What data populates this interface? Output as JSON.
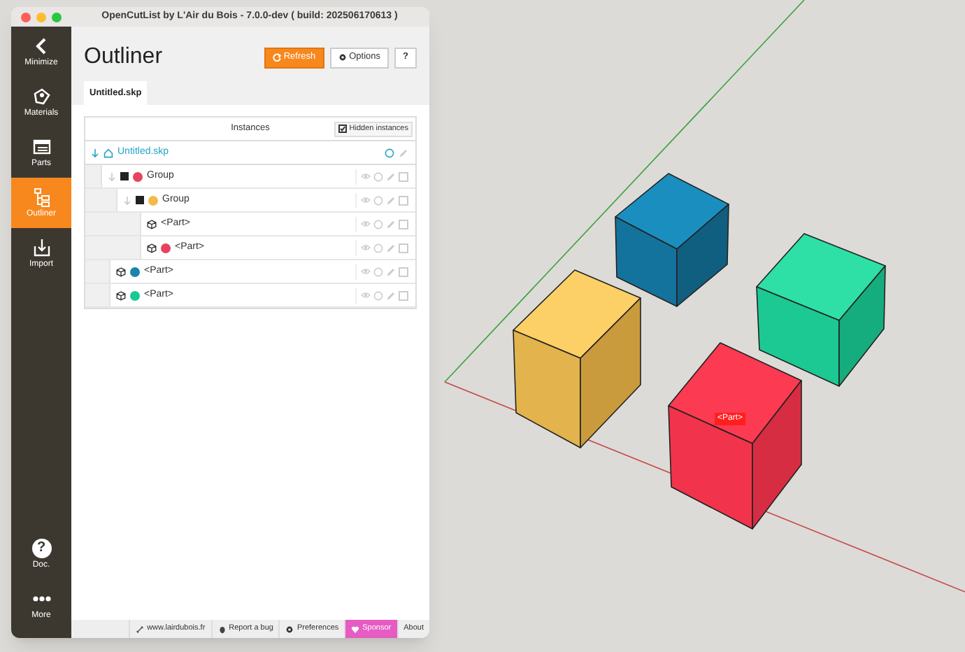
{
  "window": {
    "title": "OpenCutList by L'Air du Bois - 7.0.0-dev ( build: 202506170613 )"
  },
  "sidebar": {
    "items": [
      {
        "label": "Minimize",
        "kind": "chevron",
        "selected": false
      },
      {
        "label": "Materials",
        "kind": "materials",
        "selected": false
      },
      {
        "label": "Parts",
        "kind": "parts",
        "selected": false
      },
      {
        "label": "Outliner",
        "kind": "outliner",
        "selected": true
      },
      {
        "label": "Import",
        "kind": "import",
        "selected": false
      }
    ],
    "bottom_items": [
      {
        "label": "Doc.",
        "kind": "help",
        "symbol": "?"
      },
      {
        "label": "More",
        "kind": "dots"
      }
    ]
  },
  "header": {
    "title": "Outliner",
    "buttons": [
      {
        "label": "Refresh",
        "kind": "primary"
      },
      {
        "label": "Options",
        "kind": "options"
      },
      {
        "label": "?",
        "kind": "help"
      }
    ]
  },
  "tabs": [
    {
      "label": "Untitled.skp",
      "selected": true
    }
  ],
  "outliner": {
    "column": "Instances",
    "hidden_instances": {
      "label": "Hidden instances",
      "checked": true
    },
    "root": {
      "name": "Untitled.skp",
      "expanded": true,
      "children": [
        {
          "kind": "group",
          "name": "Group",
          "color": "#e8435e",
          "expanded": true,
          "checked": false,
          "children": [
            {
              "kind": "group",
              "name": "Group",
              "color": "#f2bb4b",
              "expanded": true,
              "checked": false,
              "children": [
                {
                  "kind": "part",
                  "name": "<Part>",
                  "checked": false
                },
                {
                  "kind": "part",
                  "name": "<Part>",
                  "color": "#e8435e",
                  "checked": false
                }
              ]
            }
          ]
        },
        {
          "kind": "part",
          "name": "<Part>",
          "color": "#1a84ad",
          "checked": false
        },
        {
          "kind": "part",
          "name": "<Part>",
          "color": "#18c993",
          "checked": false
        }
      ]
    }
  },
  "footer": [
    {
      "label": "www.lairdubois.fr",
      "kind": "link"
    },
    {
      "label": "Report a bug",
      "kind": "bug"
    },
    {
      "label": "Preferences",
      "kind": "gear"
    },
    {
      "label": "Sponsor",
      "kind": "sponsor"
    },
    {
      "label": "About",
      "kind": "plain"
    }
  ],
  "viewport": {
    "tag": "<Part>"
  }
}
